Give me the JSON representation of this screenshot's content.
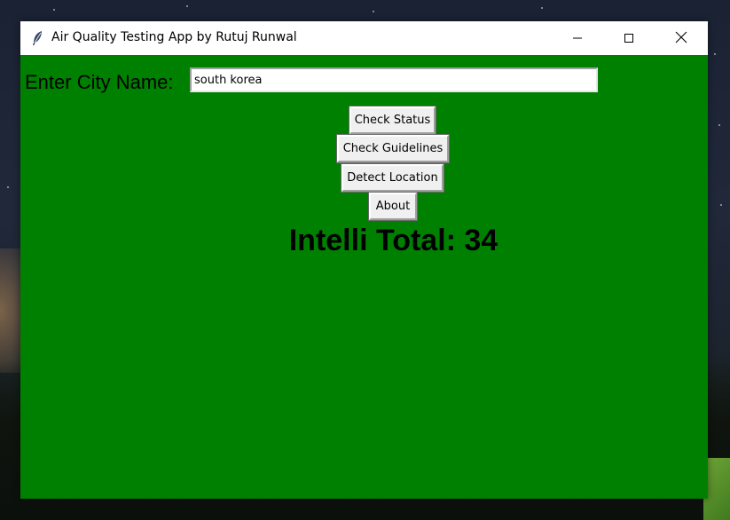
{
  "window": {
    "title": "Air Quality Testing App by Rutuj Runwal",
    "minimize_glyph": "—",
    "maximize_glyph": "☐",
    "close_glyph": "✕",
    "app_icon": "feather-icon"
  },
  "form": {
    "city_label": "Enter City Name:",
    "city_value": "south korea"
  },
  "buttons": {
    "check_status": "Check Status",
    "check_guidelines": "Check Guidelines",
    "detect_location": "Detect Location",
    "about": "About"
  },
  "result": {
    "text": "Intelli Total: 34"
  },
  "colors": {
    "background": "#008000",
    "button": "#f0f0f0"
  }
}
